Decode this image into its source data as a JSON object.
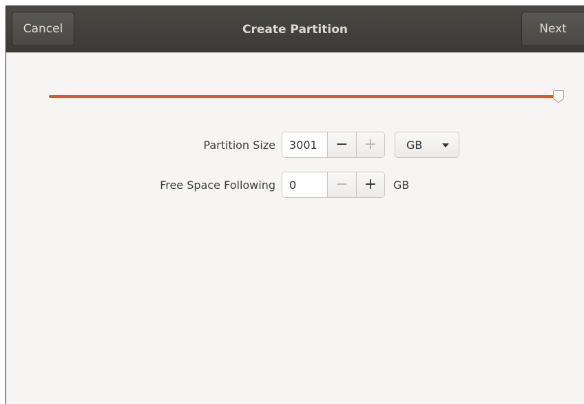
{
  "header": {
    "cancel_label": "Cancel",
    "title": "Create Partition",
    "next_label": "Next"
  },
  "slider": {
    "fraction": 1.0,
    "accent_color": "#e95420"
  },
  "partition_size": {
    "label": "Partition Size",
    "value": "3001",
    "minus": "−",
    "plus": "+",
    "unit_selected": "GB"
  },
  "free_space": {
    "label": "Free Space Following",
    "value": "0",
    "minus": "−",
    "plus": "+",
    "unit": "GB"
  },
  "icons": {
    "slider_handle": "slider-handle-icon",
    "dropdown": "triangle-down-icon"
  }
}
